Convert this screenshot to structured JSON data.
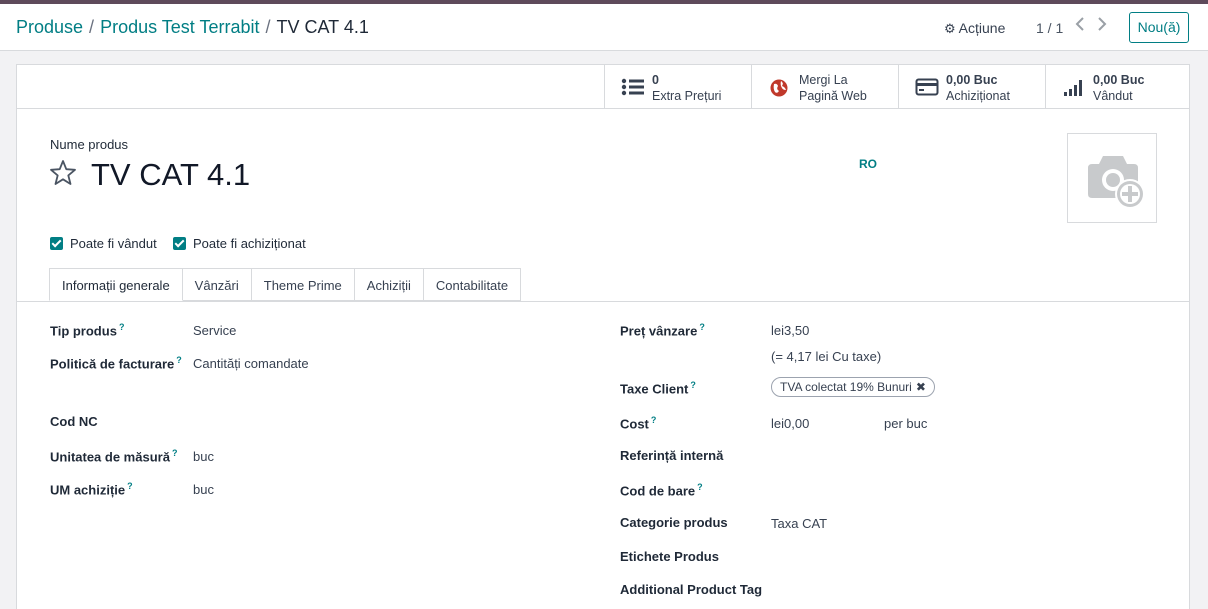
{
  "breadcrumb": {
    "items": [
      "Produse",
      "Produs Test Terrabit"
    ],
    "current": "TV CAT 4.1",
    "separator": "/"
  },
  "toolbar": {
    "action_label": "Acțiune",
    "pager": "1 / 1",
    "new_label": "Nou(ă)"
  },
  "stat_buttons": [
    {
      "line1": "0",
      "line2": "Extra Prețuri",
      "icon": "list-icon"
    },
    {
      "line1": "Mergi La",
      "line2": "Pagină Web",
      "icon": "globe-icon"
    },
    {
      "line1": "0,00 Buc",
      "line2": "Achiziționat",
      "icon": "credit-card-icon"
    },
    {
      "line1": "0,00 Buc",
      "line2": "Vândut",
      "icon": "signal-bars-icon"
    }
  ],
  "product": {
    "name_label": "Nume produs",
    "name": "TV CAT 4.1",
    "lang": "RO",
    "can_be_sold_label": "Poate fi vândut",
    "can_be_sold": true,
    "can_be_purchased_label": "Poate fi achiziționat",
    "can_be_purchased": true
  },
  "tabs": [
    {
      "label": "Informații generale",
      "active": true
    },
    {
      "label": "Vânzări",
      "active": false
    },
    {
      "label": "Theme Prime",
      "active": false
    },
    {
      "label": "Achiziții",
      "active": false
    },
    {
      "label": "Contabilitate",
      "active": false
    }
  ],
  "left_fields": [
    {
      "label": "Tip produs",
      "help": "?",
      "value": "Service"
    },
    {
      "label": "Politică de facturare",
      "help": "?",
      "value": "Cantități comandate"
    },
    {
      "label": "Cod NC",
      "help": "",
      "value": ""
    },
    {
      "label": "Unitatea de măsură",
      "help": "?",
      "value": "buc"
    },
    {
      "label": "UM achiziție",
      "help": "?",
      "value": "buc"
    }
  ],
  "right_fields": {
    "sale_price_label": "Preț vânzare",
    "sale_price": "lei3,50",
    "sale_price_taxed": "(= 4,17 lei Cu taxe)",
    "taxes_label": "Taxe Client",
    "tax_tag": "TVA colectat 19% Bunuri",
    "tax_tag_remove": "✖",
    "cost_label": "Cost",
    "cost": "lei0,00",
    "cost_unit": "per buc",
    "internal_ref_label": "Referință internă",
    "barcode_label": "Cod de bare",
    "category_label": "Categorie produs",
    "category": "Taxa CAT",
    "tags_label": "Etichete Produs",
    "additional_tag_label": "Additional Product Tag",
    "help": "?"
  },
  "colors": {
    "accent": "#017e84",
    "topline": "#5e4a5b",
    "link": "#017e84"
  }
}
